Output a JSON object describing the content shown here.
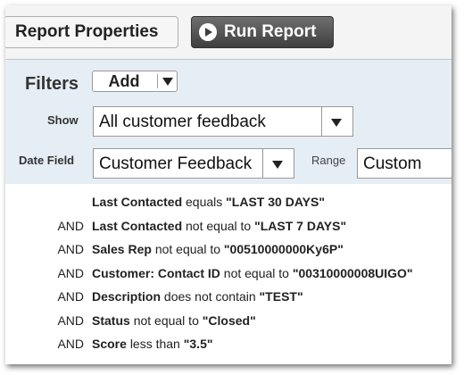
{
  "toolbar": {
    "report_properties_label": "Report Properties",
    "run_report_label": "Run Report"
  },
  "filters": {
    "title": "Filters",
    "add_label": "Add",
    "show_label": "Show",
    "show_value": "All customer feedback",
    "date_field_label": "Date Field",
    "date_field_value": "Customer Feedback",
    "range_label": "Range",
    "range_value": "Custom"
  },
  "criteria": [
    {
      "connector": "",
      "field": "Last Contacted",
      "operator": "equals",
      "value": "\"LAST 30 DAYS\""
    },
    {
      "connector": "AND",
      "field": "Last Contacted",
      "operator": "not equal to",
      "value": "\"LAST 7 DAYS\""
    },
    {
      "connector": "AND",
      "field": "Sales Rep",
      "operator": "not equal to",
      "value": "\"00510000000Ky6P\""
    },
    {
      "connector": "AND",
      "field": "Customer: Contact ID",
      "operator": "not equal to",
      "value": "\"00310000008UIGO\""
    },
    {
      "connector": "AND",
      "field": "Description",
      "operator": "does not contain",
      "value": "\"TEST\""
    },
    {
      "connector": "AND",
      "field": "Status",
      "operator": "not equal to",
      "value": "\"Closed\""
    },
    {
      "connector": "AND",
      "field": "Score",
      "operator": "less than",
      "value": "\"3.5\""
    }
  ],
  "icons": {
    "run": "play-icon",
    "dropdown": "chevron-down-icon"
  }
}
